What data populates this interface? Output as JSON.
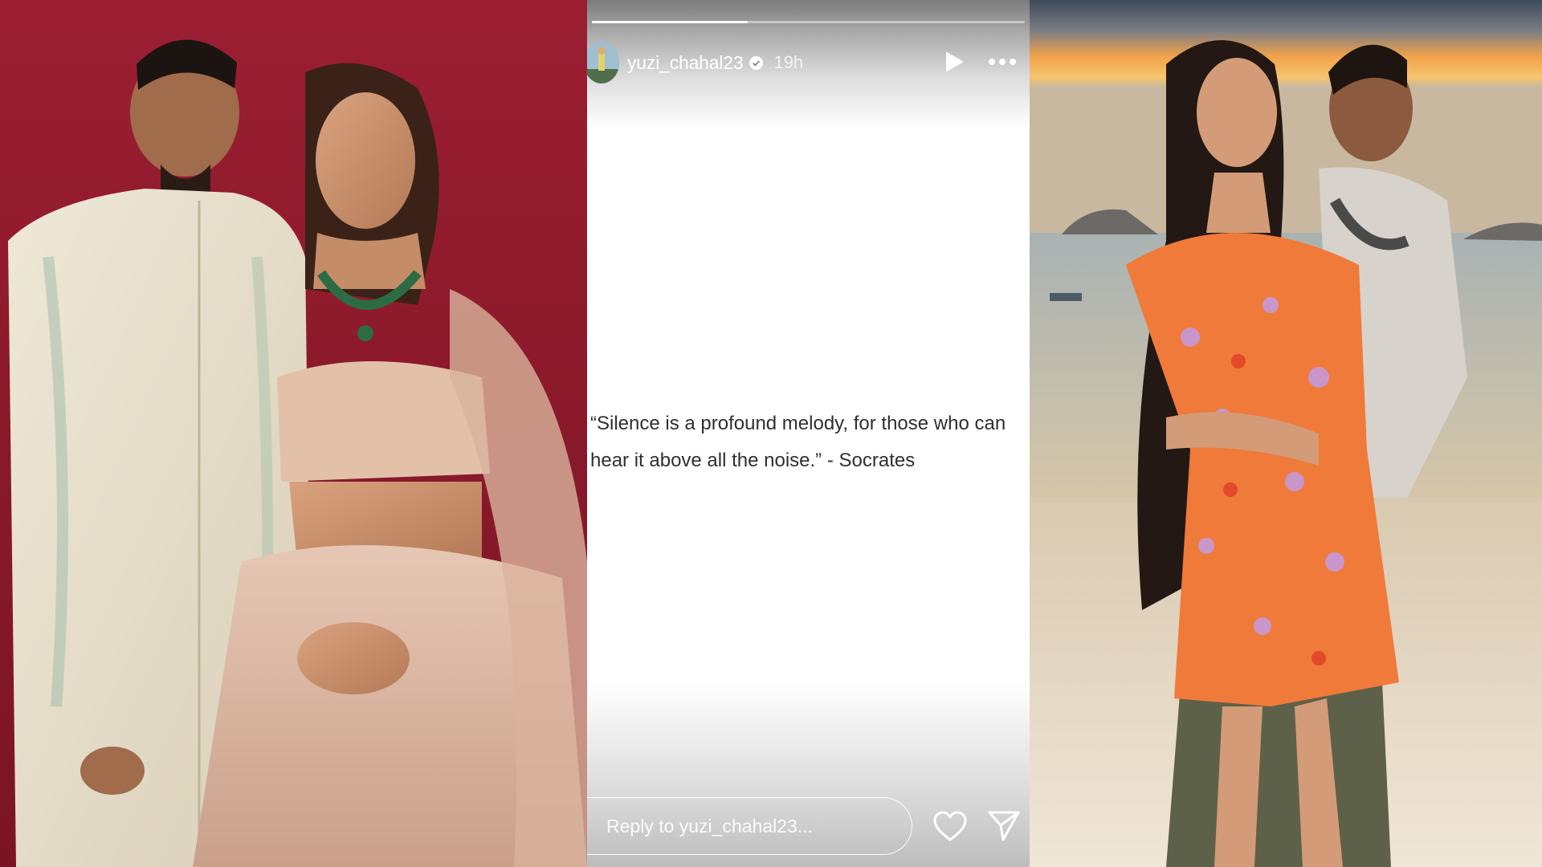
{
  "story": {
    "username": "yuzi_chahal23",
    "time_ago": "19h",
    "progress_fraction": 0.36,
    "quote": "“Silence is a profound melody, for those who can hear it above all the noise.” - Socrates",
    "reply_placeholder": "Reply to yuzi_chahal23...",
    "icons": {
      "verified": "verified-badge-icon",
      "play": "play-icon",
      "more": "more-options-icon",
      "like": "heart-icon",
      "share": "send-icon"
    }
  },
  "colors": {
    "left_backdrop": "#8b1a2b",
    "sunset_sky": "#f2a24a",
    "quote_text": "#2f2f2f"
  }
}
